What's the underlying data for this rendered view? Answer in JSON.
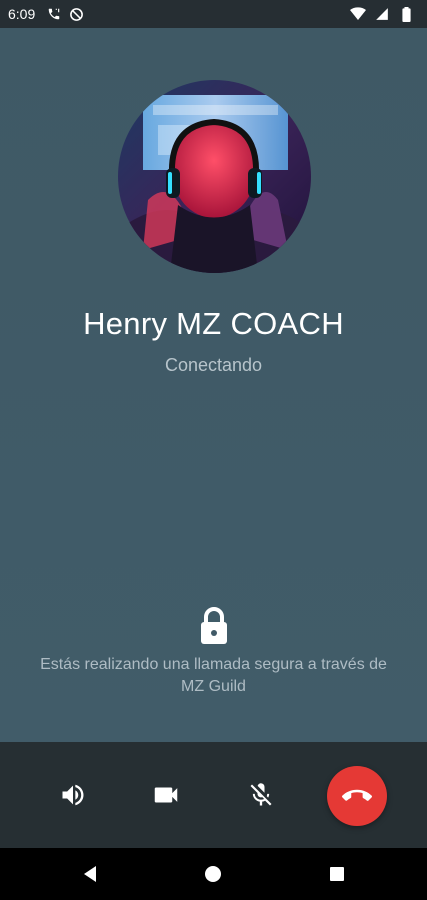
{
  "status_bar": {
    "time": "6:09",
    "icons": [
      "phone-call-icon",
      "no-disturb-icon",
      "wifi-icon",
      "signal-icon",
      "battery-icon"
    ]
  },
  "call": {
    "caller_name": "Henry MZ COACH",
    "status": "Conectando",
    "avatar": "avatar-gamer-headphones",
    "secure_notice": "Estás realizando una llamada segura a través de MZ Guild",
    "secure_icon": "lock-icon"
  },
  "controls": {
    "speaker_icon": "speaker-icon",
    "video_icon": "video-camera-icon",
    "mute_icon": "mic-off-icon",
    "end_call_icon": "end-call-icon",
    "end_call_color": "#e53935"
  },
  "nav_bar": {
    "icons": [
      "back-icon",
      "home-icon",
      "recents-icon"
    ]
  },
  "colors": {
    "background": "#405a67",
    "control_bar": "#262f33",
    "status_bar": "#262e33"
  }
}
